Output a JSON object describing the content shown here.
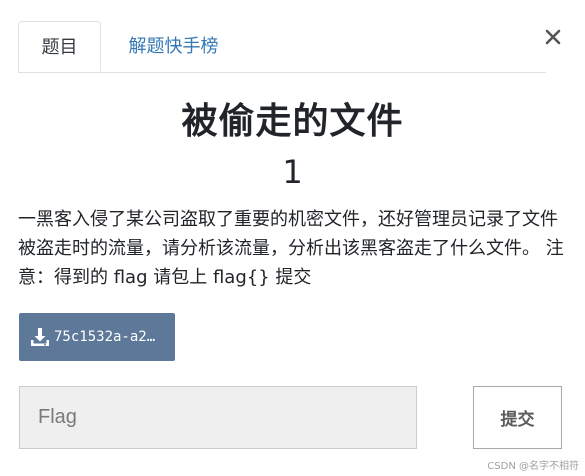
{
  "tabs": [
    {
      "label": "题目",
      "active": true
    },
    {
      "label": "解题快手榜",
      "active": false
    }
  ],
  "close_icon": "close-icon",
  "challenge": {
    "title": "被偷走的文件",
    "points": "1",
    "description": "一黑客入侵了某公司盗取了重要的机密文件，还好管理员记录了文件被盗走时的流量，请分析该流量，分析出该黑客盗走了什么文件。 注意：得到的 flag 请包上 flag{} 提交"
  },
  "download": {
    "icon": "download-icon",
    "filename": "75c1532a-a2…"
  },
  "flag_input": {
    "placeholder": "Flag",
    "value": ""
  },
  "submit_label": "提交",
  "watermark": "CSDN @名字不相符",
  "colors": {
    "tab_link": "#3478b6",
    "download_bg": "#5d7899",
    "input_bg": "#efefef"
  }
}
